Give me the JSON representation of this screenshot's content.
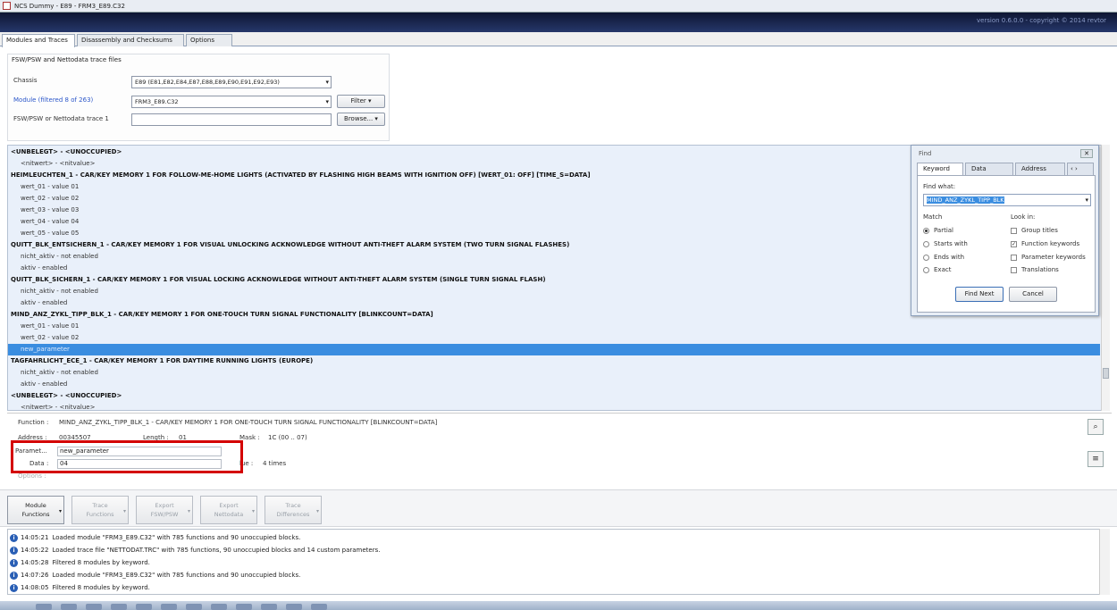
{
  "window": {
    "title": "NCS Dummy - E89 - FRM3_E89.C32",
    "version": "version 0.6.0.0 - copyright © 2014 revtor"
  },
  "tabs": [
    "Modules and Traces",
    "Disassembly and Checksums",
    "Options"
  ],
  "files": {
    "header": "FSW/PSW and Nettodata trace files",
    "chassis_label": "Chassis",
    "chassis_value": "E89 (E81,E82,E84,E87,E88,E89,E90,E91,E92,E93)",
    "module_label": "Module (filtered 8 of 263)",
    "module_value": "FRM3_E89.C32",
    "filter_button": "Filter",
    "trace_label": "FSW/PSW or Nettodata trace 1",
    "trace_value": "",
    "browse_button": "Browse..."
  },
  "tree": {
    "rows": [
      {
        "kind": "fn",
        "text": "<UNBELEGT> - <UNOCCUPIED>"
      },
      {
        "kind": "val",
        "text": "<nitwert> - <nitvalue>"
      },
      {
        "kind": "fn",
        "text": "HEIMLEUCHTEN_1 - CAR/KEY MEMORY 1 FOR FOLLOW-ME-HOME LIGHTS (ACTIVATED BY FLASHING HIGH BEAMS WITH IGNITION OFF) [WERT_01: OFF] [TIME_S=DATA]"
      },
      {
        "kind": "val",
        "text": "wert_01 - value 01"
      },
      {
        "kind": "val",
        "text": "wert_02 - value 02"
      },
      {
        "kind": "val",
        "text": "wert_03 - value 03"
      },
      {
        "kind": "val",
        "text": "wert_04 - value 04"
      },
      {
        "kind": "val",
        "text": "wert_05 - value 05"
      },
      {
        "kind": "fn",
        "text": "QUITT_BLK_ENTSICHERN_1 - CAR/KEY MEMORY 1 FOR VISUAL UNLOCKING ACKNOWLEDGE WITHOUT ANTI-THEFT ALARM SYSTEM (TWO TURN SIGNAL FLASHES)"
      },
      {
        "kind": "val",
        "text": "nicht_aktiv - not enabled"
      },
      {
        "kind": "val",
        "text": "aktiv - enabled"
      },
      {
        "kind": "fn",
        "text": "QUITT_BLK_SICHERN_1 - CAR/KEY MEMORY 1 FOR VISUAL LOCKING ACKNOWLEDGE WITHOUT ANTI-THEFT ALARM SYSTEM (SINGLE TURN SIGNAL FLASH)"
      },
      {
        "kind": "val",
        "text": "nicht_aktiv - not enabled"
      },
      {
        "kind": "val",
        "text": "aktiv - enabled"
      },
      {
        "kind": "fn",
        "text": "MIND_ANZ_ZYKL_TIPP_BLK_1 - CAR/KEY MEMORY 1 FOR ONE-TOUCH TURN SIGNAL FUNCTIONALITY [BLINKCOUNT=DATA]"
      },
      {
        "kind": "val",
        "text": "wert_01 - value 01"
      },
      {
        "kind": "val",
        "text": "wert_02 - value 02"
      },
      {
        "kind": "sel",
        "text": "new_parameter"
      },
      {
        "kind": "fn",
        "text": "TAGFAHRLICHT_ECE_1 - CAR/KEY MEMORY 1 FOR DAYTIME RUNNING LIGHTS (EUROPE)"
      },
      {
        "kind": "val",
        "text": "nicht_aktiv - not enabled"
      },
      {
        "kind": "val",
        "text": "aktiv - enabled"
      },
      {
        "kind": "fn",
        "text": "<UNBELEGT> - <UNOCCUPIED>"
      },
      {
        "kind": "val",
        "text": "<nitwert> - <nitvalue>"
      }
    ]
  },
  "find": {
    "title": "Find",
    "tabs": [
      "Keyword",
      "Data",
      "Address"
    ],
    "find_what_label": "Find what:",
    "find_what_value": "MIND_ANZ_ZYKL_TIPP_BLK",
    "match_label": "Match",
    "match_options": [
      "Partial",
      "Starts with",
      "Ends with",
      "Exact"
    ],
    "lookin_label": "Look in:",
    "lookin_options": [
      "Group titles",
      "Function keywords",
      "Parameter keywords",
      "Translations"
    ],
    "find_next": "Find Next",
    "cancel": "Cancel"
  },
  "details": {
    "function_label": "Function :",
    "function_value": "MIND_ANZ_ZYKL_TIPP_BLK_1 - CAR/KEY MEMORY 1 FOR ONE-TOUCH TURN SIGNAL FUNCTIONALITY [BLINKCOUNT=DATA]",
    "address_label": "Address :",
    "address_value": "00345507",
    "length_label": "Length :",
    "length_value": "01",
    "mask_label": "Mask :",
    "mask_value": "1C (00 .. 07)",
    "parameter_label": "Paramet...",
    "parameter_value": "new_parameter",
    "data_label": "Data :",
    "data_value": "04",
    "value_label": "lue :",
    "value_value": "4 times",
    "options_label": "Options :"
  },
  "toolbar": [
    {
      "line1": "Module",
      "line2": "Functions",
      "enabled": true
    },
    {
      "line1": "Trace",
      "line2": "Functions",
      "enabled": false
    },
    {
      "line1": "Export",
      "line2": "FSW/PSW",
      "enabled": false
    },
    {
      "line1": "Export",
      "line2": "Nettodata",
      "enabled": false
    },
    {
      "line1": "Trace",
      "line2": "Differences",
      "enabled": false
    }
  ],
  "log": [
    {
      "time": "14:05:21",
      "msg": "Loaded module \"FRM3_E89.C32\" with 785 functions and 90 unoccupied blocks."
    },
    {
      "time": "14:05:22",
      "msg": "Loaded trace file \"NETTODAT.TRC\" with 785 functions, 90 unoccupied blocks and 14 custom parameters."
    },
    {
      "time": "14:05:28",
      "msg": "Filtered 8 modules by keyword."
    },
    {
      "time": "14:07:26",
      "msg": "Loaded module \"FRM3_E89.C32\" with 785 functions and 90 unoccupied blocks."
    },
    {
      "time": "14:08:05",
      "msg": "Filtered 8 modules by keyword."
    }
  ]
}
